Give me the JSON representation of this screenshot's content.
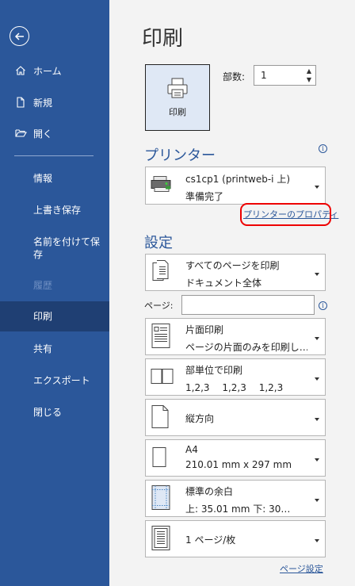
{
  "sidebar": {
    "nav_top": [
      {
        "name": "home",
        "label": "ホーム",
        "icon": "home-icon"
      },
      {
        "name": "new",
        "label": "新規",
        "icon": "new-document-icon"
      },
      {
        "name": "open",
        "label": "開く",
        "icon": "folder-open-icon"
      }
    ],
    "nav_bottom": [
      {
        "name": "info",
        "label": "情報"
      },
      {
        "name": "save",
        "label": "上書き保存"
      },
      {
        "name": "save-as",
        "label": "名前を付けて保存"
      },
      {
        "name": "history",
        "label": "履歴",
        "disabled": true
      },
      {
        "name": "print",
        "label": "印刷",
        "active": true
      },
      {
        "name": "share",
        "label": "共有"
      },
      {
        "name": "export",
        "label": "エクスポート"
      },
      {
        "name": "close",
        "label": "閉じる"
      }
    ]
  },
  "main": {
    "title": "印刷",
    "print_button_label": "印刷",
    "copies_label": "部数:",
    "copies_value": "1",
    "printer_section_title": "プリンター",
    "printer": {
      "name": "cs1cp1 (printweb-i 上)",
      "status": "準備完了"
    },
    "printer_properties_link": "プリンターのプロパティ",
    "settings_section_title": "設定",
    "settings": [
      {
        "name": "print-range",
        "line1": "すべてのページを印刷",
        "line2": "ドキュメント全体",
        "icon": "pages-icon"
      },
      {
        "name": "sides",
        "line1": "片面印刷",
        "line2": "ページの片面のみを印刷し…",
        "icon": "one-sided-icon"
      },
      {
        "name": "collation",
        "line1": "部単位で印刷",
        "line2": "1,2,3　 1,2,3　 1,2,3",
        "icon": "collate-icon"
      },
      {
        "name": "orientation",
        "line1": "縦方向",
        "line2": "",
        "icon": "portrait-icon"
      },
      {
        "name": "paper-size",
        "line1": "A4",
        "line2": "210.01 mm x 297 mm",
        "icon": "paper-size-icon"
      },
      {
        "name": "margins",
        "line1": "標準の余白",
        "line2": "上: 35.01 mm 下: 30…",
        "icon": "margins-icon"
      },
      {
        "name": "pages-per-sheet",
        "line1": "1 ページ/枚",
        "line2": "",
        "icon": "pages-per-sheet-icon"
      }
    ],
    "pages_label": "ページ:",
    "pages_value": "",
    "page_setup_link": "ページ設定"
  }
}
